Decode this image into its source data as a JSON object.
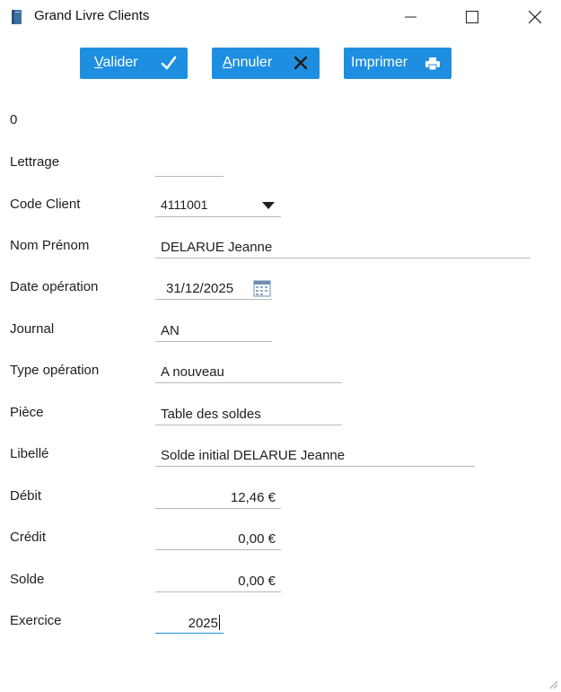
{
  "window": {
    "title": "Grand Livre Clients",
    "icon": "book-icon"
  },
  "toolbar": {
    "valider": {
      "first": "V",
      "rest": "alider"
    },
    "annuler": {
      "first": "A",
      "rest": "nnuler"
    },
    "imprimer_label": "Imprimer"
  },
  "colors": {
    "accent": "#1e8fe0"
  },
  "form": {
    "counter": "0",
    "lettrage_label": "Lettrage",
    "lettrage_value": "",
    "code_client_label": "Code Client",
    "code_client_value": "4111001",
    "nom_prenom_label": "Nom Prénom",
    "nom_prenom_value": "DELARUE Jeanne",
    "date_operation_label": "Date opération",
    "date_operation_value": "31/12/2025",
    "journal_label": "Journal",
    "journal_value": "AN",
    "type_operation_label": "Type opération",
    "type_operation_value": "A nouveau",
    "piece_label": "Pièce",
    "piece_value": "Table des soldes",
    "libelle_label": "Libellé",
    "libelle_value": "Solde initial DELARUE Jeanne",
    "debit_label": "Débit",
    "debit_value": "12,46 €",
    "credit_label": "Crédit",
    "credit_value": "0,00 €",
    "solde_label": "Solde",
    "solde_value": "0,00 €",
    "exercice_label": "Exercice",
    "exercice_value": "2025"
  }
}
